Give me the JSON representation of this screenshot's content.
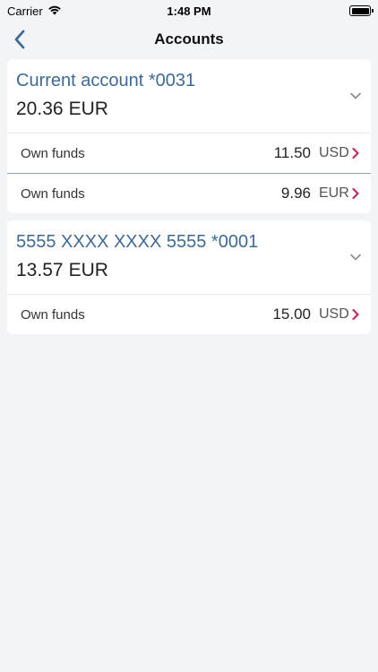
{
  "status": {
    "carrier": "Carrier",
    "time": "1:48 PM"
  },
  "nav": {
    "title": "Accounts"
  },
  "colors": {
    "accent": "#3e6a94",
    "arrow": "#c8285a",
    "background": "#f2f4f8"
  },
  "accounts": [
    {
      "name": "Current account *0031",
      "balance": "20.36",
      "currency": "EUR",
      "rows": [
        {
          "label": "Own funds",
          "amount": "11.50",
          "currency": "USD"
        },
        {
          "label": "Own funds",
          "amount": "9.96",
          "currency": "EUR"
        }
      ]
    },
    {
      "name": "5555 XXXX XXXX 5555 *0001",
      "balance": "13.57",
      "currency": "EUR",
      "rows": [
        {
          "label": "Own funds",
          "amount": "15.00",
          "currency": "USD"
        }
      ]
    }
  ]
}
